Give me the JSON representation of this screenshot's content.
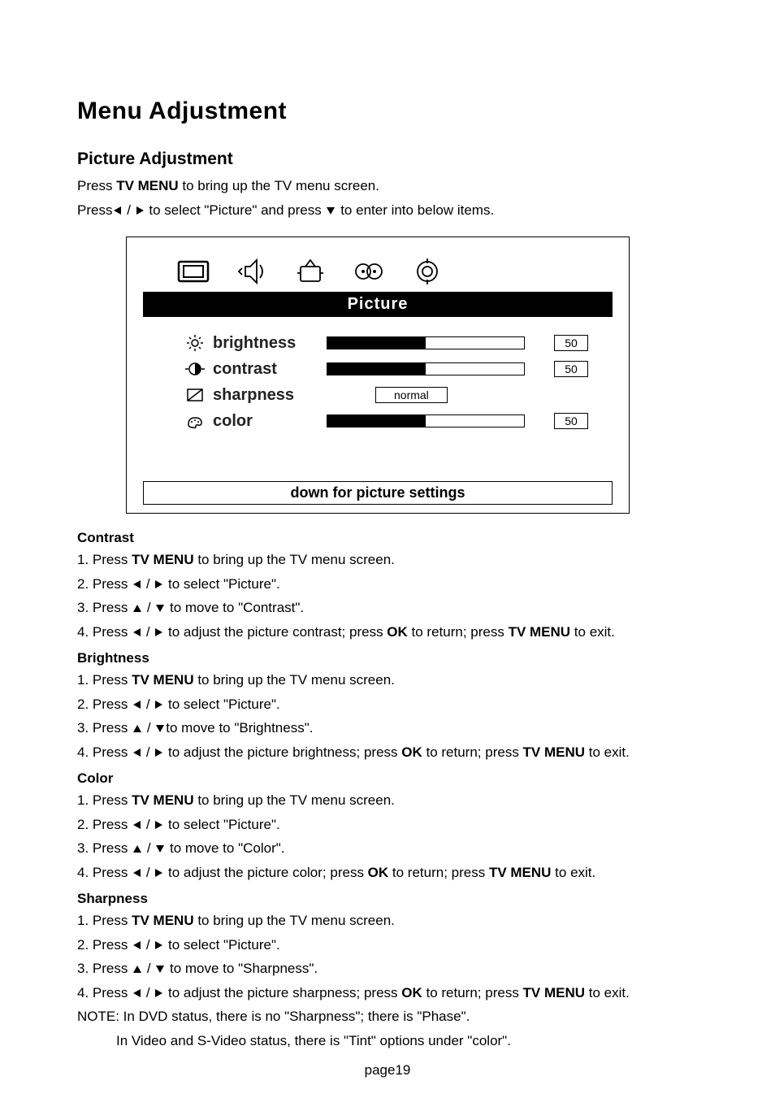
{
  "title": "Menu Adjustment",
  "subtitle": "Picture Adjustment",
  "intro1_a": "Press ",
  "intro1_b": "TV MENU",
  "intro1_c": " to bring up the TV menu screen.",
  "intro2_a": "Press",
  "intro2_b": " / ",
  "intro2_c": " to select \"Picture\" and press ",
  "intro2_d": " to enter into below items.",
  "osd": {
    "title": "Picture",
    "rows": {
      "brightness": {
        "label": "brightness",
        "value": "50",
        "fill": 50
      },
      "contrast": {
        "label": "contrast",
        "value": "50",
        "fill": 50
      },
      "sharpness": {
        "label": "sharpness",
        "option": "normal"
      },
      "color": {
        "label": "color",
        "value": "50",
        "fill": 50
      }
    },
    "footer": "down for picture settings"
  },
  "sections": {
    "contrast": {
      "heading": "Contrast",
      "s1a": "1. Press ",
      "s1b": "TV MENU",
      "s1c": " to bring up the TV menu screen.",
      "s2a": "2. Press ",
      "s2b": " / ",
      "s2c": " to select \"Picture\".",
      "s3a": "3. Press  ",
      "s3b": " / ",
      "s3c": " to move to \"Contrast\".",
      "s4a": "4. Press ",
      "s4b": " / ",
      "s4c": " to adjust the picture contrast; press ",
      "s4d": "OK",
      "s4e": " to return; press ",
      "s4f": "TV MENU",
      "s4g": " to exit."
    },
    "brightness": {
      "heading": "Brightness",
      "s1a": "1. Press ",
      "s1b": "TV MENU",
      "s1c": " to bring up the TV menu screen.",
      "s2a": "2. Press ",
      "s2b": " / ",
      "s2c": " to select \"Picture\".",
      "s3a": "3. Press ",
      "s3b": " /  ",
      "s3c": "to move to \"Brightness\".",
      "s4a": "4. Press ",
      "s4b": " / ",
      "s4c": " to adjust the picture brightness; press ",
      "s4d": "OK",
      "s4e": " to return; press ",
      "s4f": "TV MENU",
      "s4g": " to exit."
    },
    "color": {
      "heading": "Color",
      "s1a": "1. Press ",
      "s1b": "TV MENU",
      "s1c": " to bring up the TV menu screen.",
      "s2a": "2. Press ",
      "s2b": " / ",
      "s2c": " to select \"Picture\".",
      "s3a": "3. Press ",
      "s3b": " / ",
      "s3c": " to move to \"Color\".",
      "s4a": "4. Press ",
      "s4b": " / ",
      "s4c": " to adjust the picture color; press ",
      "s4d": "OK",
      "s4e": " to return; press ",
      "s4f": "TV MENU",
      "s4g": " to exit."
    },
    "sharpness": {
      "heading": "Sharpness",
      "s1a": "1. Press ",
      "s1b": "TV MENU",
      "s1c": " to bring up the TV menu screen.",
      "s2a": "2. Press ",
      "s2b": " / ",
      "s2c": " to select \"Picture\".",
      "s3a": "3. Press ",
      "s3b": " / ",
      "s3c": " to move to \"Sharpness\".",
      "s4a": "4. Press ",
      "s4b": " / ",
      "s4c": " to adjust the picture sharpness; press ",
      "s4d": "OK",
      "s4e": " to return; press ",
      "s4f": "TV MENU",
      "s4g": " to exit."
    }
  },
  "note1": "NOTE: In DVD status, there is no \"Sharpness\"; there is \"Phase\".",
  "note2": "In Video and S-Video status, there is \"Tint\" options under \"color\".",
  "pagenum": "page19"
}
